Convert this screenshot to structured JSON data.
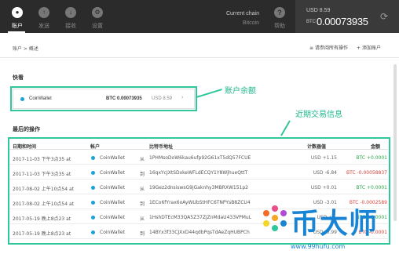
{
  "nav": {
    "items": [
      {
        "label": "账户",
        "icon": "account-icon",
        "active": true
      },
      {
        "label": "发送",
        "icon": "send-icon",
        "active": false
      },
      {
        "label": "接收",
        "icon": "receive-icon",
        "active": false
      },
      {
        "label": "设置",
        "icon": "settings-icon",
        "active": false
      }
    ],
    "help_label": "帮助"
  },
  "chain": {
    "label": "Current chain",
    "value": "Bitcoin"
  },
  "balance": {
    "usd": "USD 8.59",
    "btc_unit": "BTC",
    "btc": "0.00073935"
  },
  "breadcrumb": "账户 > 概述",
  "actions": {
    "show_all": "请参阅所有操作",
    "add_account": "添加账户"
  },
  "favorites": {
    "title": "快看",
    "wallet": {
      "name": "CoinWallet",
      "btc": "BTC 0.00073935",
      "usd": "USD 8.59",
      "arrow": "›"
    }
  },
  "annotations": {
    "balance": "账户余额",
    "recent": "近期交易信息"
  },
  "recent": {
    "title": "最后的操作",
    "columns": [
      "日期和时间",
      "帐户",
      "比特币地址",
      "计数器值",
      "金额"
    ],
    "rows": [
      {
        "date": "2017-11-03 下午3点35 at",
        "account": "CoinWallet",
        "dir": "从",
        "address": "1PHMsoDoW6kau6ufp92G61xT5dQ57FCUE",
        "usd": "USD +1.15",
        "btc": "BTC +0.0001",
        "sign": "pos"
      },
      {
        "date": "2017-11-03 下午3点35 at",
        "account": "CoinWallet",
        "dir": "到",
        "address": "16qxYcJXtSDxkeWFLdECQY1Y8WjhueQttT",
        "usd": "USD -6.84",
        "btc": "BTC -0.00058837",
        "sign": "neg"
      },
      {
        "date": "2017-08-02 上午10点54 at",
        "account": "CoinWallet",
        "dir": "从",
        "address": "19Gez2dnsiswsG9jGaknhy3MBRXW151p2",
        "usd": "USD +0.01",
        "btc": "BTC +0.0001",
        "sign": "pos"
      },
      {
        "date": "2017-08-02 上午10点54 at",
        "account": "CoinWallet",
        "dir": "到",
        "address": "1ECo6fYrax6oAyWUbStHFC6TNPYsB8ZCU4",
        "usd": "USD -3.01",
        "btc": "BTC -0.0002589",
        "sign": "neg"
      },
      {
        "date": "2017-05-19 晚上8点23 at",
        "account": "CoinWallet",
        "dir": "从",
        "address": "1HshDTEcM33QA5Z37ZjZnMdaU433VPMuL",
        "usd": "USD +0.",
        "btc": "BTC +0.0001",
        "sign": "pos"
      },
      {
        "date": "2017-05-19 晚上8点23 at",
        "account": "CoinWallet",
        "dir": "到",
        "address": "14BYx3f33CJXxD44qdbPqsTdAeZqHUBPCh",
        "usd": "USD -0.99",
        "btc": "BTC -0.0001",
        "sign": "neg"
      }
    ]
  },
  "watermark": {
    "text": "币大师",
    "url": "www.99hufu.com"
  },
  "colors": {
    "topbar": "#2b2b2b",
    "annotation": "#2fc79b",
    "positive": "#2ba84a",
    "negative": "#d9443c",
    "dot": "#1aa3d9",
    "watermark": "#1a84d4"
  }
}
